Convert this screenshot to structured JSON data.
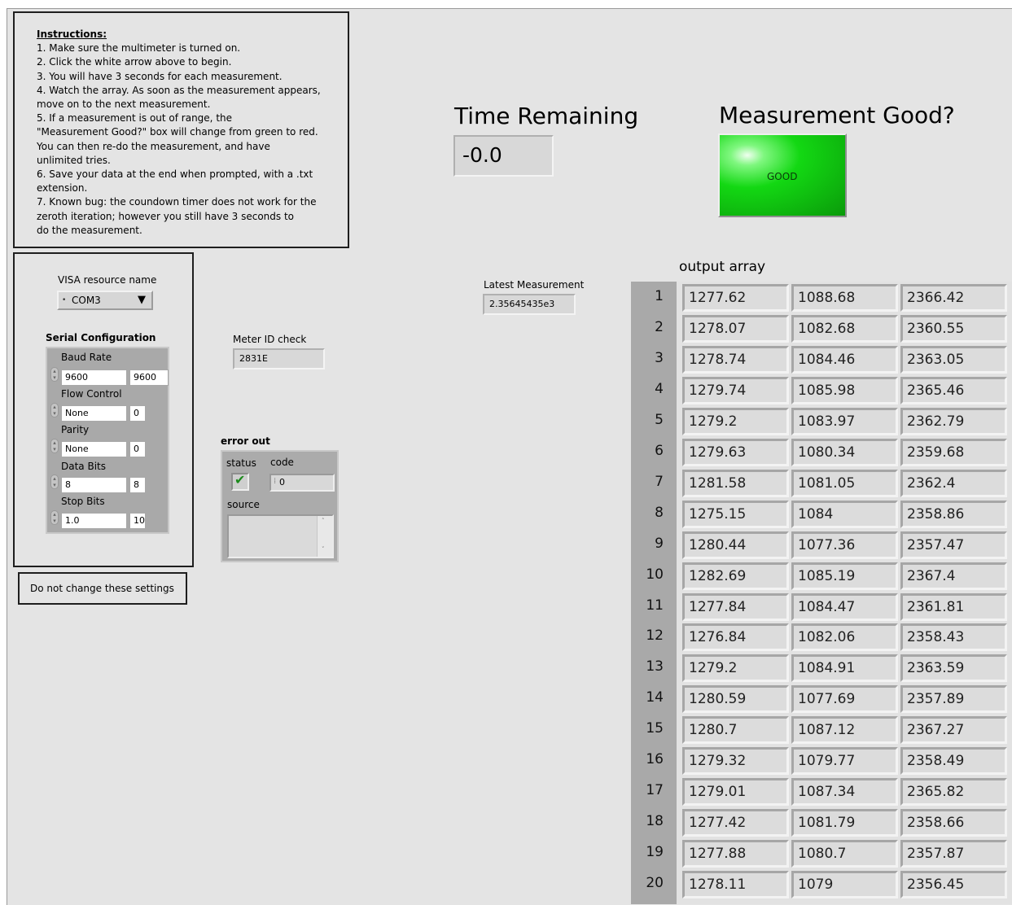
{
  "instructions": {
    "title": "Instructions:",
    "lines": [
      "1. Make sure the multimeter is turned on.",
      "2. Click the white arrow above to begin.",
      "3. You will have 3 seconds for each measurement.",
      "4.  Watch the array.  As soon as the measurement appears,",
      "move on to the next measurement.",
      "5.  If a measurement is out of range, the",
      "\"Measurement Good?\" box will change from green to red.",
      "You can then re-do the measurement, and have",
      "unlimited tries.",
      "6. Save your data at the end when prompted, with a .txt",
      "extension.",
      "7. Known bug: the coundown timer does not work for the",
      "zeroth iteration; however you still have 3 seconds to",
      "do the measurement."
    ]
  },
  "visa": {
    "label": "VISA resource name",
    "value": "COM3"
  },
  "serial": {
    "title": "Serial Configuration",
    "baud_label": "Baud Rate",
    "baud_value": "9600",
    "baud_num": "9600",
    "flow_label": "Flow Control",
    "flow_value": "None",
    "flow_num": "0",
    "parity_label": "Parity",
    "parity_value": "None",
    "parity_num": "0",
    "databits_label": "Data Bits",
    "databits_value": "8",
    "databits_num": "8",
    "stopbits_label": "Stop Bits",
    "stopbits_value": "1.0",
    "stopbits_num": "10"
  },
  "note": "Do not change these settings",
  "meter": {
    "label": "Meter ID check",
    "value": "2831E"
  },
  "error_out": {
    "title": "error out",
    "status_label": "status",
    "code_label": "code",
    "code_value": "0",
    "source_label": "source",
    "source_value": ""
  },
  "latest": {
    "label": "Latest Measurement",
    "value": "2.35645435e3"
  },
  "time_remaining": {
    "label": "Time Remaining",
    "value": "-0.0"
  },
  "measurement_good": {
    "label": "Measurement Good?",
    "value": "GOOD",
    "color": "#13d813"
  },
  "output_array": {
    "label": "output array",
    "rows": [
      [
        "1",
        "1277.62",
        "1088.68",
        "2366.42"
      ],
      [
        "2",
        "1278.07",
        "1082.68",
        "2360.55"
      ],
      [
        "3",
        "1278.74",
        "1084.46",
        "2363.05"
      ],
      [
        "4",
        "1279.74",
        "1085.98",
        "2365.46"
      ],
      [
        "5",
        "1279.2",
        "1083.97",
        "2362.79"
      ],
      [
        "6",
        "1279.63",
        "1080.34",
        "2359.68"
      ],
      [
        "7",
        "1281.58",
        "1081.05",
        "2362.4"
      ],
      [
        "8",
        "1275.15",
        "1084",
        "2358.86"
      ],
      [
        "9",
        "1280.44",
        "1077.36",
        "2357.47"
      ],
      [
        "10",
        "1282.69",
        "1085.19",
        "2367.4"
      ],
      [
        "11",
        "1277.84",
        "1084.47",
        "2361.81"
      ],
      [
        "12",
        "1276.84",
        "1082.06",
        "2358.43"
      ],
      [
        "13",
        "1279.2",
        "1084.91",
        "2363.59"
      ],
      [
        "14",
        "1280.59",
        "1077.69",
        "2357.89"
      ],
      [
        "15",
        "1280.7",
        "1087.12",
        "2367.27"
      ],
      [
        "16",
        "1279.32",
        "1079.77",
        "2358.49"
      ],
      [
        "17",
        "1279.01",
        "1087.34",
        "2365.82"
      ],
      [
        "18",
        "1277.42",
        "1081.79",
        "2358.66"
      ],
      [
        "19",
        "1277.88",
        "1080.7",
        "2357.87"
      ],
      [
        "20",
        "1278.11",
        "1079",
        "2356.45"
      ]
    ]
  }
}
